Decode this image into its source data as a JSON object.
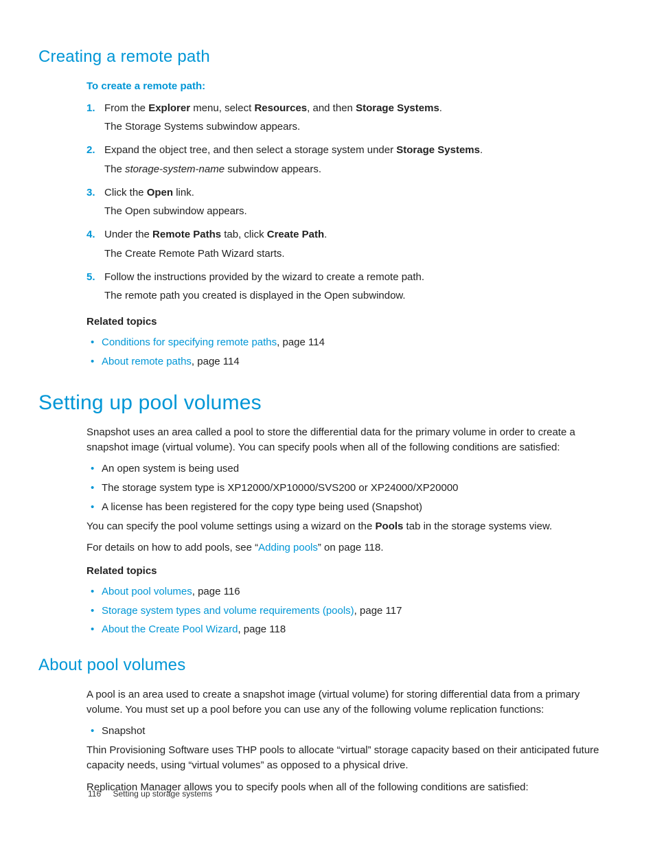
{
  "sections": {
    "creating_remote_path": {
      "heading": "Creating a remote path",
      "procedure_title": "To create a remote path:",
      "steps": [
        {
          "num": "1.",
          "l1_pre": "From the ",
          "l1_b1": "Explorer",
          "l1_mid1": " menu, select ",
          "l1_b2": "Resources",
          "l1_mid2": ", and then ",
          "l1_b3": "Storage Systems",
          "l1_post": ".",
          "l2": "The Storage Systems subwindow appears."
        },
        {
          "num": "2.",
          "l1_pre": "Expand the object tree, and then select a storage system under ",
          "l1_b1": "Storage Systems",
          "l1_post": ".",
          "l2_pre": "The ",
          "l2_i": "storage-system-name",
          "l2_post": " subwindow appears."
        },
        {
          "num": "3.",
          "l1_pre": "Click the ",
          "l1_b1": "Open",
          "l1_post": " link.",
          "l2": "The Open subwindow appears."
        },
        {
          "num": "4.",
          "l1_pre": "Under the ",
          "l1_b1": "Remote Paths",
          "l1_mid1": " tab, click ",
          "l1_b2": "Create Path",
          "l1_post": ".",
          "l2": "The Create Remote Path Wizard starts."
        },
        {
          "num": "5.",
          "l1": "Follow the instructions provided by the wizard to create a remote path.",
          "l2": "The remote path you created is displayed in the Open subwindow."
        }
      ],
      "related_heading": "Related topics",
      "related": [
        {
          "link": "Conditions for specifying remote paths",
          "suffix": ", page 114"
        },
        {
          "link": "About remote paths",
          "suffix": ", page 114"
        }
      ]
    },
    "setting_up_pool": {
      "heading": "Setting up pool volumes",
      "intro": "Snapshot uses an area called a pool to store the differential data for the primary volume in order to create a snapshot image (virtual volume). You can specify pools when all of the following conditions are satisfied:",
      "conditions": [
        "An open system is being used",
        "The storage system type is XP12000/XP10000/SVS200 or XP24000/XP20000",
        "A license has been registered for the copy type being used (Snapshot)"
      ],
      "after_pre": "You can specify the pool volume settings using a wizard on the ",
      "after_b": "Pools",
      "after_post": " tab in the storage systems view.",
      "details_pre": " For details on how to add pools, see “",
      "details_link": "Adding pools",
      "details_post": "” on page 118.",
      "related_heading": "Related topics",
      "related": [
        {
          "link": "About pool volumes",
          "suffix": ", page 116"
        },
        {
          "link": "Storage system types and volume requirements (pools)",
          "suffix": ", page 117"
        },
        {
          "link": "About the Create Pool Wizard",
          "suffix": ", page 118"
        }
      ]
    },
    "about_pool_volumes": {
      "heading": "About pool volumes",
      "p1": "A pool is an area used to create a snapshot image (virtual volume) for storing differential data from a primary volume. You must set up a pool before you can use any of the following volume replication functions:",
      "bullets": [
        "Snapshot"
      ],
      "p2": "Thin Provisioning Software uses THP pools to allocate “virtual” storage capacity based on their anticipated future capacity needs, using “virtual volumes” as opposed to a physical drive.",
      "p3": "Replication Manager allows you to specify pools when all of the following conditions are satisfied:"
    }
  },
  "footer": {
    "page_number": "116",
    "chapter": "Setting up storage systems"
  }
}
